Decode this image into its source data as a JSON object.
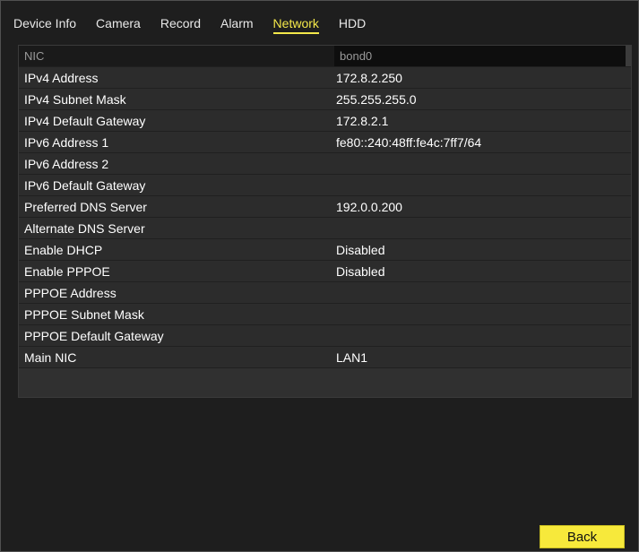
{
  "tabs": [
    {
      "label": "Device Info",
      "active": false
    },
    {
      "label": "Camera",
      "active": false
    },
    {
      "label": "Record",
      "active": false
    },
    {
      "label": "Alarm",
      "active": false
    },
    {
      "label": "Network",
      "active": true
    },
    {
      "label": "HDD",
      "active": false
    }
  ],
  "table": {
    "header": {
      "label": "NIC",
      "value": "bond0"
    },
    "rows": [
      {
        "label": "IPv4 Address",
        "value": "172.8.2.250"
      },
      {
        "label": "IPv4 Subnet Mask",
        "value": "255.255.255.0"
      },
      {
        "label": "IPv4 Default Gateway",
        "value": "172.8.2.1"
      },
      {
        "label": "IPv6 Address 1",
        "value": "fe80::240:48ff:fe4c:7ff7/64"
      },
      {
        "label": "IPv6 Address 2",
        "value": ""
      },
      {
        "label": "IPv6 Default Gateway",
        "value": ""
      },
      {
        "label": "Preferred DNS Server",
        "value": "192.0.0.200"
      },
      {
        "label": "Alternate DNS Server",
        "value": ""
      },
      {
        "label": "Enable DHCP",
        "value": "Disabled"
      },
      {
        "label": "Enable PPPOE",
        "value": "Disabled"
      },
      {
        "label": "PPPOE Address",
        "value": ""
      },
      {
        "label": "PPPOE Subnet Mask",
        "value": ""
      },
      {
        "label": "PPPOE Default Gateway",
        "value": ""
      },
      {
        "label": "Main NIC",
        "value": "LAN1"
      }
    ]
  },
  "buttons": {
    "back": "Back"
  },
  "colors": {
    "accent": "#f4e84a",
    "button": "#f7e93b",
    "background": "#1e1e1e"
  }
}
